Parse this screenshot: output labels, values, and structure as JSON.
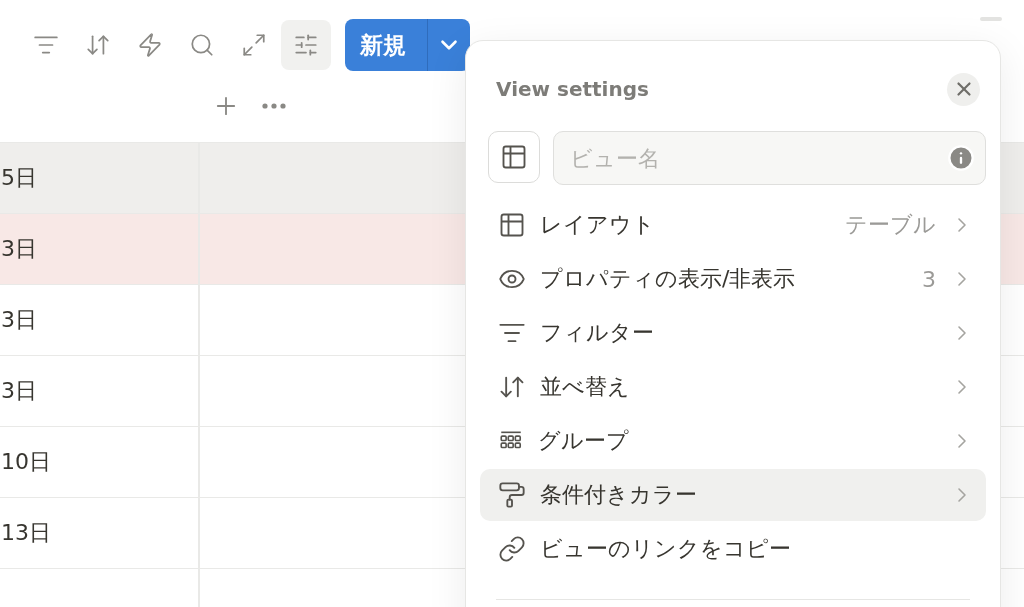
{
  "toolbar": {
    "tools": [
      {
        "kind": "filter",
        "selected": false
      },
      {
        "kind": "sort",
        "selected": false
      },
      {
        "kind": "automation",
        "selected": false
      },
      {
        "kind": "search",
        "selected": false
      },
      {
        "kind": "expand",
        "selected": false
      },
      {
        "kind": "settings",
        "selected": true
      }
    ],
    "new_button": {
      "label": "新規"
    }
  },
  "table": {
    "rows": [
      {
        "date": "5日",
        "color": "#efeeec"
      },
      {
        "date": "3日",
        "color": "#f8e8e6"
      },
      {
        "date": "3日",
        "color": "#ffffff"
      },
      {
        "date": "3日",
        "color": "#ffffff"
      },
      {
        "date": "10日",
        "color": "#ffffff"
      },
      {
        "date": "13日",
        "color": "#ffffff"
      }
    ]
  },
  "view_settings": {
    "title": "View settings",
    "view_name": {
      "placeholder": "ビュー名"
    },
    "items": [
      {
        "kind": "layout",
        "label": "レイアウト",
        "value": "テーブル",
        "selected": false
      },
      {
        "kind": "properties",
        "label": "プロパティの表示/非表示",
        "value": "3",
        "selected": false
      },
      {
        "kind": "filter",
        "label": "フィルター",
        "selected": false
      },
      {
        "kind": "sort",
        "label": "並べ替え",
        "selected": false
      },
      {
        "kind": "group",
        "label": "グループ",
        "selected": false
      },
      {
        "kind": "color",
        "label": "条件付きカラー",
        "selected": true
      },
      {
        "kind": "link",
        "label": "ビューのリンクをコピー",
        "selected": false
      }
    ]
  }
}
